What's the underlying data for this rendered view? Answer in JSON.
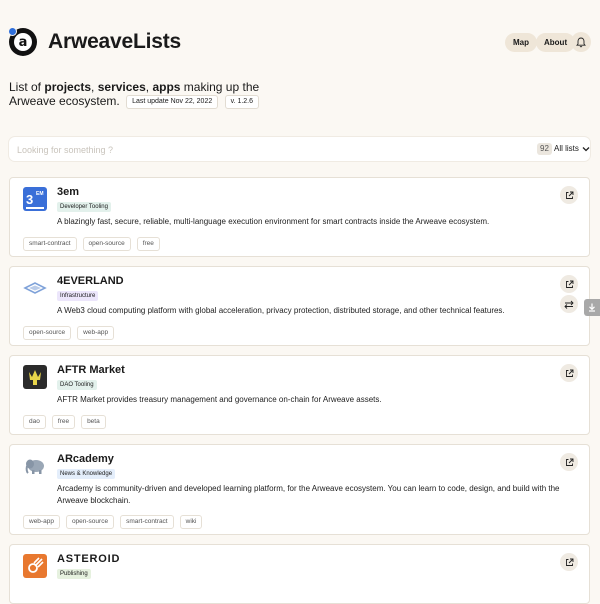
{
  "header": {
    "title": "ArweaveLists",
    "logo_letter": "a",
    "map_label": "Map",
    "about_label": "About"
  },
  "intro": {
    "line_start": "List of ",
    "projects": "projects",
    "comma1": ", ",
    "services": "services",
    "comma2": ", ",
    "apps": "apps",
    "line_end": " making up the",
    "line2": "Arweave ecosystem.",
    "last_update": "Last update Nov 22, 2022",
    "version": "v. 1.2.6"
  },
  "search": {
    "placeholder": "Looking for something ?",
    "count": "92",
    "lists_label": "All lists"
  },
  "colors": {
    "tooling": "#e3f1ec",
    "infra": "#ece6fb",
    "news": "#e4eefb",
    "publishing": "#e6f1df"
  },
  "cards": [
    {
      "name": "3em",
      "category": "Developer Tooling",
      "description": "A blazingly fast, secure, reliable, multi-language execution environment for smart contracts inside the Arweave ecosystem.",
      "tags": [
        "smart-contract",
        "open-source",
        "free"
      ],
      "icon": "3em-logo-icon"
    },
    {
      "name": "4EVERLAND",
      "category": "Infrastructure",
      "description": "A Web3 cloud computing platform with global acceleration, privacy protection, distributed storage, and other technical features.",
      "tags": [
        "open-source",
        "web-app"
      ],
      "icon": "4everland-logo-icon"
    },
    {
      "name": "AFTR Market",
      "category": "DAO Tooling",
      "description": "AFTR Market provides treasury management and governance on-chain for Arweave assets.",
      "tags": [
        "dao",
        "free",
        "beta"
      ],
      "icon": "aftr-logo-icon"
    },
    {
      "name": "ARcademy",
      "category": "News & Knowledge",
      "description": "Arcademy is community-driven and developed learning platform, for the Arweave ecosystem. You can learn to code, design, and build with the Arweave blockchain.",
      "tags": [
        "web-app",
        "open-source",
        "smart-contract",
        "wiki"
      ],
      "icon": "elephant-icon"
    },
    {
      "name": "ASTEROID",
      "category": "Publishing",
      "icon": "asteroid-logo-icon"
    }
  ]
}
